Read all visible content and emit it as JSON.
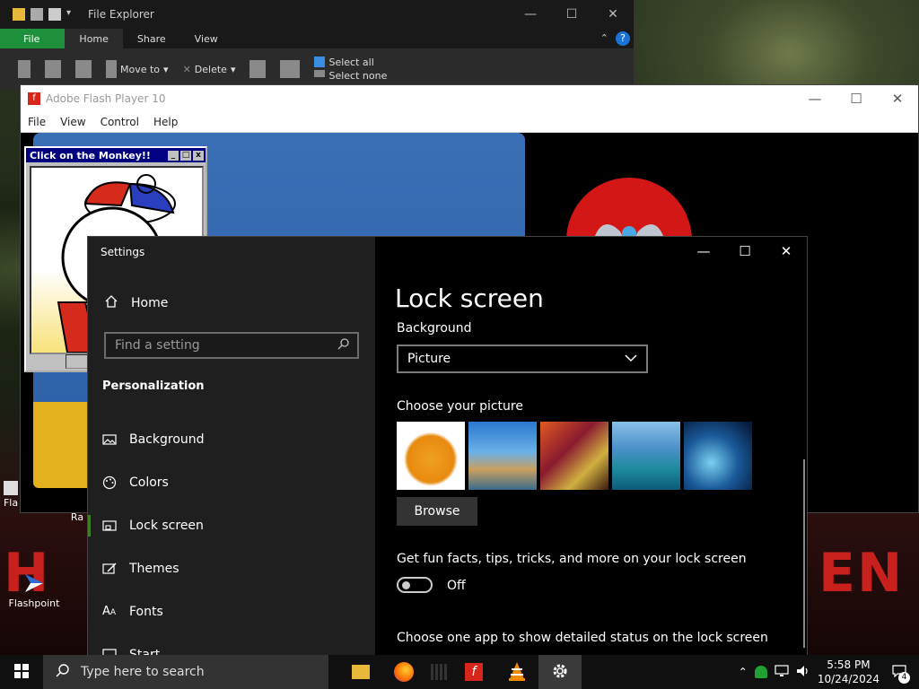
{
  "desktop": {
    "icons": [
      {
        "label": "Flashpoint"
      },
      {
        "label": "Fla"
      },
      {
        "label": "Ra"
      }
    ],
    "banner_left": "H",
    "banner_right": "EN"
  },
  "file_explorer": {
    "title": "File Explorer",
    "tabs": [
      "File",
      "Home",
      "Share",
      "View"
    ],
    "ribbon": {
      "move_to": "Move to",
      "delete": "Delete",
      "select_all": "Select all",
      "select_none": "Select none"
    }
  },
  "flash_player": {
    "title": "Adobe Flash Player 10",
    "menu": [
      "File",
      "View",
      "Control",
      "Help"
    ],
    "popup_title": "Click on the Monkey!!"
  },
  "settings": {
    "app_title": "Settings",
    "home": "Home",
    "search_placeholder": "Find a setting",
    "section": "Personalization",
    "nav": [
      "Background",
      "Colors",
      "Lock screen",
      "Themes",
      "Fonts",
      "Start"
    ],
    "active_nav": "Lock screen",
    "page_title": "Lock screen",
    "background_label": "Background",
    "background_value": "Picture",
    "choose_picture_label": "Choose your picture",
    "browse_label": "Browse",
    "fun_facts_label": "Get fun facts, tips, tricks, and more on your lock screen",
    "toggle_state": "Off",
    "detailed_status_label": "Choose one app to show detailed status on the lock screen",
    "thumbnails": [
      "pumpkin",
      "beach-arch",
      "colorful-art",
      "ocean-sailboat",
      "underwater"
    ]
  },
  "taskbar": {
    "search_placeholder": "Type here to search",
    "apps": [
      "file-explorer",
      "firefox",
      "mixer",
      "flash",
      "vlc",
      "settings"
    ],
    "active_app": "settings",
    "time": "5:58 PM",
    "date": "10/24/2024",
    "notification_count": "4"
  },
  "colors": {
    "accent": "#3f7f2a",
    "file_tab": "#1e8f3a",
    "flash_red": "#d6261c"
  }
}
